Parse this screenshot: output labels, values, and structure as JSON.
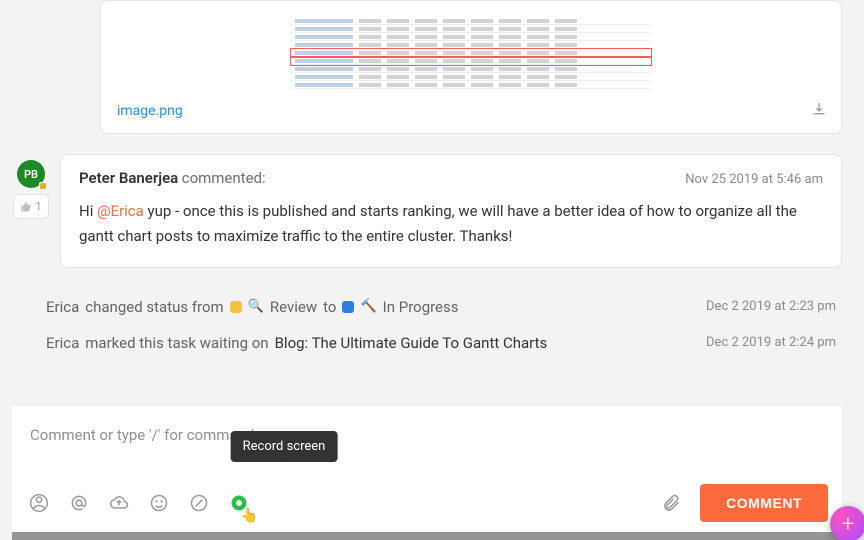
{
  "attachment": {
    "filename": "image.png"
  },
  "comment": {
    "avatar_initials": "PB",
    "author": "Peter Banerjea",
    "verb": "commented:",
    "timestamp": "Nov 25 2019 at 5:46 am",
    "prefix": "Hi ",
    "mention": "@Erica",
    "body_rest": " yup - once this is published and starts ranking, we will have a better idea of how to organize all the gantt chart posts to maximize traffic to the entire cluster. Thanks!",
    "like_count": "1"
  },
  "activity": {
    "status_change": {
      "actor": "Erica",
      "verb": "changed status from",
      "from_label": "Review",
      "to_word": "to",
      "to_label": "In Progress",
      "timestamp": "Dec 2 2019 at 2:23 pm"
    },
    "waiting": {
      "actor": "Erica",
      "verb": "marked this task waiting on",
      "task_name": "Blog: The Ultimate Guide To Gantt Charts",
      "timestamp": "Dec 2 2019 at 2:24 pm"
    }
  },
  "compose": {
    "placeholder": "Comment or type '/' for commands",
    "tooltip": "Record screen",
    "button": "COMMENT"
  }
}
